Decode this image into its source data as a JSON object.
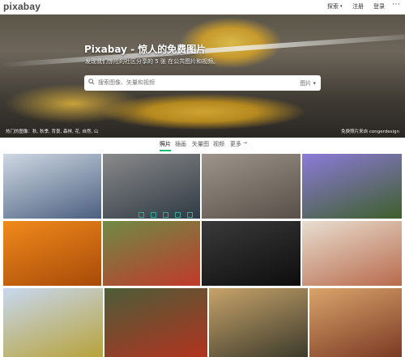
{
  "header": {
    "logo": "pixabay",
    "nav": [
      "探索",
      "注册",
      "登录"
    ],
    "more_icon": "ellipsis-icon"
  },
  "hero": {
    "title": "Pixabay - 惊人的免费图片",
    "subtitle": "发现我们惊险的社区分享的 5 张 在公共图片和视频。",
    "search_placeholder": "搜索图像、矢量和视频",
    "search_type": "图片",
    "footer_left": "热门的图像：秋, 秋季, 背景, 森林, 花, 自然, 山",
    "footer_right": "免费照片来自 congerdesign"
  },
  "tabs": [
    "照片",
    "插画",
    "矢量图",
    "视频",
    "更多"
  ],
  "active_tab": "照片",
  "photos": [
    {
      "name": "sea-horizon",
      "colors": [
        "#cfd8e3",
        "#4b6080"
      ]
    },
    {
      "name": "industrial-machinery",
      "colors": [
        "#8a8a8a",
        "#2f3a44"
      ]
    },
    {
      "name": "stone-wall",
      "colors": [
        "#9d958a",
        "#585048"
      ]
    },
    {
      "name": "purple-asters",
      "colors": [
        "#8c7ad9",
        "#3e5f2b"
      ]
    },
    {
      "name": "pumpkins",
      "colors": [
        "#f08a1c",
        "#a84a08"
      ]
    },
    {
      "name": "red-berries-branch",
      "colors": [
        "#6f8b45",
        "#c03a2a"
      ]
    },
    {
      "name": "jellyfish",
      "colors": [
        "#3a3a3a",
        "#0d0d0d"
      ]
    },
    {
      "name": "fig-bruschetta",
      "colors": [
        "#e8ded0",
        "#b86a4c"
      ]
    },
    {
      "name": "sunflower-girl",
      "colors": [
        "#c7d8f0",
        "#b8a23a"
      ]
    },
    {
      "name": "apple-on-branch",
      "colors": [
        "#4b5d38",
        "#b2331f"
      ]
    },
    {
      "name": "couple-autumn",
      "colors": [
        "#c7a36a",
        "#3d3b2c"
      ]
    },
    {
      "name": "plum-tart",
      "colors": [
        "#d9a46a",
        "#7b3a24"
      ]
    }
  ]
}
